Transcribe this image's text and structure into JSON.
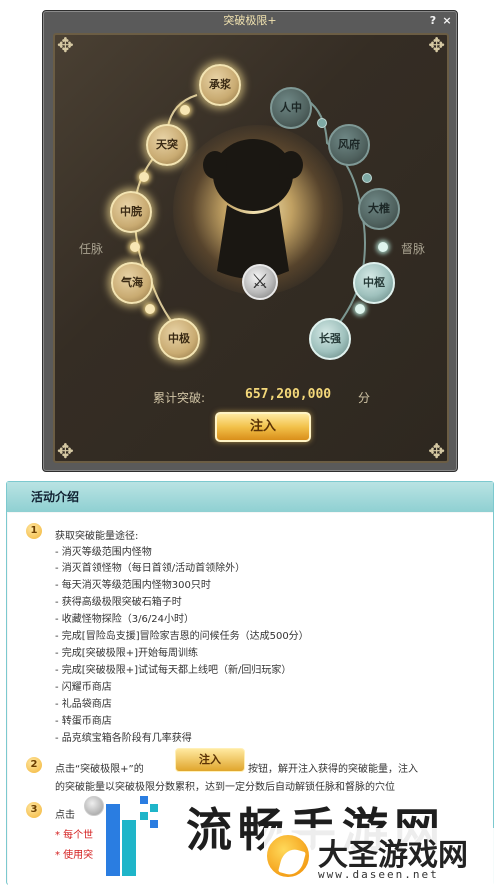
{
  "window": {
    "title": "突破极限+",
    "help_glyph": "?",
    "close_glyph": "×"
  },
  "meridian": {
    "left_label": "任脉",
    "right_label": "督脉",
    "left_nodes": [
      "承浆",
      "天突",
      "中脘",
      "气海",
      "中极"
    ],
    "right_nodes": [
      "人中",
      "风府",
      "大椎",
      "中枢",
      "长强"
    ]
  },
  "total": {
    "label": "累计突破:",
    "value": "657,200,000",
    "unit": "分"
  },
  "inject_button": "注入",
  "activity": {
    "title": "活动介绍",
    "step1_num": "1",
    "step1_title": "获取突破能量途径:",
    "step1_items": [
      "- 消灭等级范围内怪物",
      "- 消灭首领怪物（每日首领/活动首领除外）",
      "- 每天消灭等级范围内怪物300只时",
      "- 获得高级极限突破石箱子时",
      "- 收藏怪物探险（3/6/24小时）",
      "- 完成[冒险岛支援]冒险家吉恩的问候任务（达成500分）",
      "- 完成[突破极限+]开始每周训练",
      "- 完成[突破极限+]试试每天都上线吧（新/回归玩家）",
      "- 闪耀币商店",
      "- 礼品袋商店",
      "- 转蛋币商店",
      "- 品克缤宝箱各阶段有几率获得"
    ],
    "step2_num": "2",
    "step2_pre": "点击“突破极限+”的",
    "step2_btn": "注入",
    "step2_post": "按钮，解开注入获得的突破能量，注入",
    "step2_line2": "的突破能量以突破极限分数累积，达到一定分数后自动解锁任脉和督脉的穴位",
    "step3_num": "3",
    "step3_text": "点击",
    "note1": "* 每个世",
    "note2": "* 使用突"
  },
  "watermark": {
    "text": "流畅手游网",
    "brand_name": "大圣游戏网",
    "brand_url": "www.daseen.net"
  }
}
